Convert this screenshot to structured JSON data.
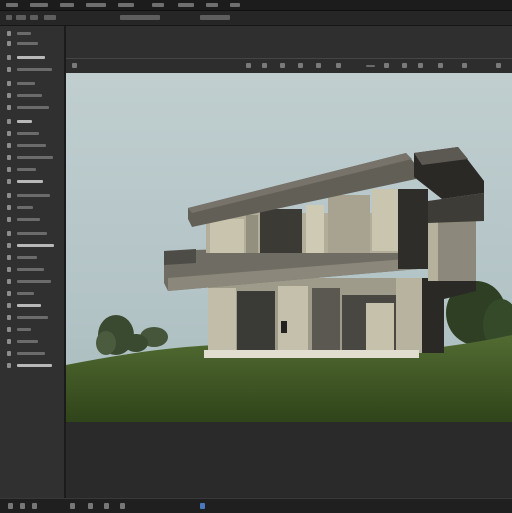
{
  "app": {
    "accent_color": "#4a78c0",
    "panel_color": "#303030",
    "menubar_color": "#1c1c1c"
  },
  "menubar": {
    "items": [
      {
        "name": "menu-item-1"
      },
      {
        "name": "menu-item-2"
      },
      {
        "name": "menu-item-3"
      },
      {
        "name": "menu-item-4"
      },
      {
        "name": "menu-item-5"
      },
      {
        "name": "menu-item-6"
      },
      {
        "name": "menu-item-7"
      },
      {
        "name": "menu-item-8"
      },
      {
        "name": "menu-item-9"
      }
    ]
  },
  "tools_panel": {
    "icon": "tool-icon",
    "item_count": 28
  },
  "document_bar": {
    "icons": [
      "layer-icon",
      "grid-icon",
      "move-icon",
      "zoom-icon",
      "rotate-icon",
      "crop-icon",
      "brush-icon",
      "eraser-icon",
      "fill-icon",
      "text-icon",
      "shape-icon",
      "hand-icon",
      "view-icon",
      "close-icon"
    ]
  },
  "canvas": {
    "subject": "modern-house-render",
    "sky_color": "#b9c7c8",
    "grass_color": "#3f5a25",
    "concrete_color": "#b7b2a0",
    "shadow_color": "#2b2a28"
  },
  "bottombar": {
    "icons": [
      "status-icon",
      "timeline-icon",
      "frame-icon",
      "play-icon",
      "stop-icon",
      "loop-icon",
      "audio-icon",
      "settings-icon"
    ]
  }
}
